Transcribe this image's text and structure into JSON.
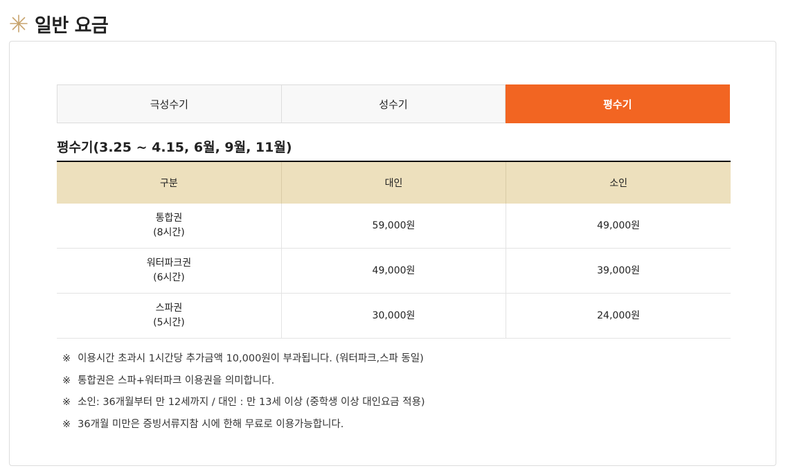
{
  "header": {
    "icon": "star-icon",
    "accent": "#c8a46e",
    "title": "일반 요금"
  },
  "tabs": [
    {
      "label": "극성수기",
      "active": false
    },
    {
      "label": "성수기",
      "active": false
    },
    {
      "label": "평수기",
      "active": true
    }
  ],
  "colors": {
    "active_tab": "#f26522",
    "table_header_bg": "#ede0bd"
  },
  "season_title": "평수기(3.25 ~ 4.15, 6월, 9월, 11월)",
  "table": {
    "headers": [
      "구분",
      "대인",
      "소인"
    ],
    "rows": [
      {
        "name": "통합권",
        "duration": "(8시간)",
        "adult": "59,000원",
        "child": "49,000원"
      },
      {
        "name": "워터파크권",
        "duration": "(6시간)",
        "adult": "49,000원",
        "child": "39,000원"
      },
      {
        "name": "스파권",
        "duration": "(5시간)",
        "adult": "30,000원",
        "child": "24,000원"
      }
    ]
  },
  "notes": {
    "mark": "※",
    "items": [
      "이용시간 초과시 1시간당 추가금액 10,000원이 부과됩니다. (워터파크,스파 동일)",
      "통합권은 스파+워터파크 이용권을 의미합니다.",
      "소인: 36개월부터 만 12세까지 / 대인 : 만 13세 이상 (중학생 이상 대인요금 적용)",
      "36개월 미만은 증빙서류지참 시에 한해 무료로 이용가능합니다."
    ]
  }
}
